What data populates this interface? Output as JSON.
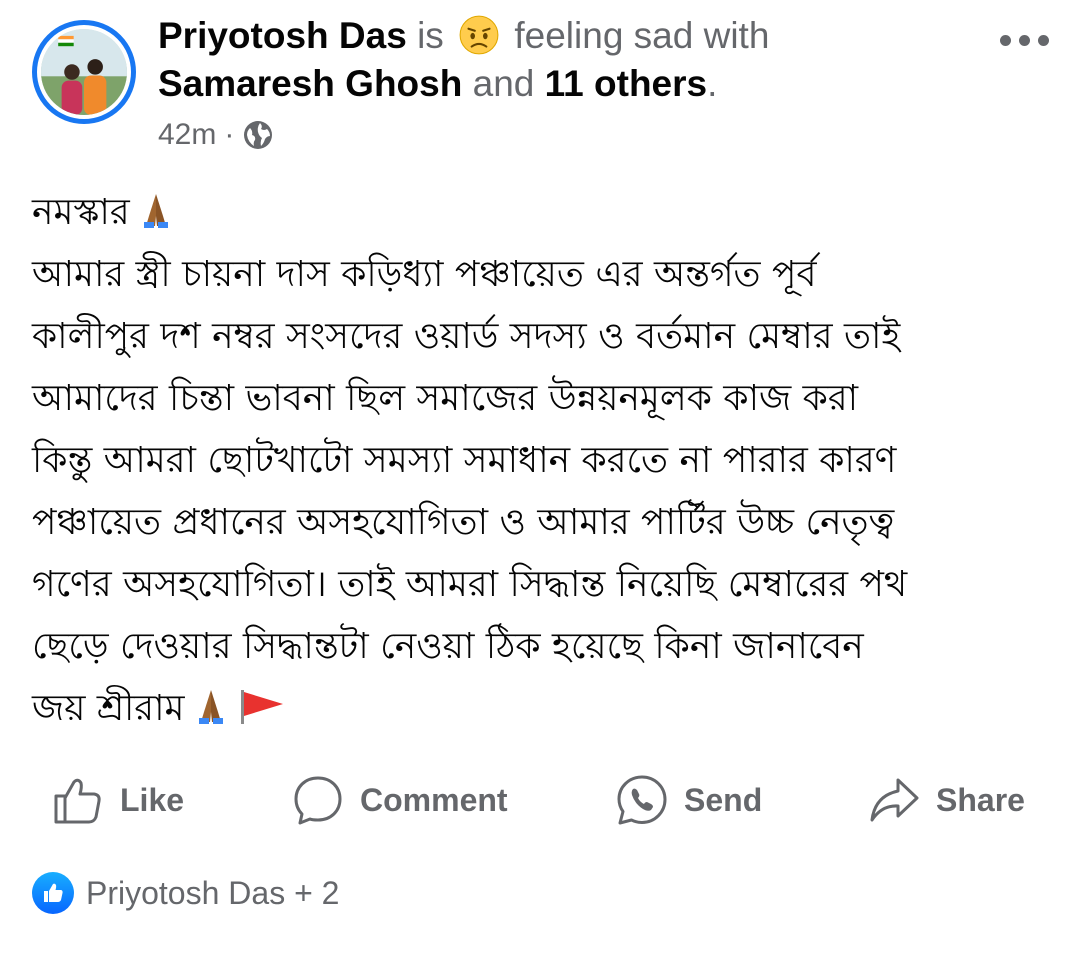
{
  "header": {
    "author": "Priyotosh Das",
    "is_text": "is",
    "feeling_text": "feeling sad with",
    "tagged": "Samaresh Ghosh",
    "and_text": "and",
    "others": "11 others",
    "period": ".",
    "time": "42m",
    "separator": "·",
    "feeling_icon": "sad-face-emoji",
    "privacy_icon": "globe-icon"
  },
  "body": {
    "lines": [
      "নমস্কার",
      "আমার স্ত্রী চায়না দাস কড়িধ্যা পঞ্চায়েত এর অন্তর্গত পূর্ব",
      "কালীপুর দশ নম্বর সংসদের ওয়ার্ড সদস্য ও বর্তমান মেম্বার তাই",
      "আমাদের চিন্তা ভাবনা ছিল সমাজের উন্নয়নমূলক কাজ করা",
      "কিন্তু আমরা ছোটখাটো সমস্যা সমাধান করতে না পারার কারণ",
      "পঞ্চায়েত প্রধানের অসহযোগিতা ও আমার পার্টির উচ্চ নেতৃত্ব",
      "গণের অসহযোগিতা। তাই আমরা সিদ্ধান্ত নিয়েছি মেম্বারের পথ",
      "ছেড়ে দেওয়ার সিদ্ধান্তটা নেওয়া ঠিক হয়েছে কিনা জানাবেন",
      "জয় শ্রীরাম"
    ]
  },
  "actions": {
    "like": "Like",
    "comment": "Comment",
    "send": "Send",
    "share": "Share"
  },
  "reactions": {
    "summary": "Priyotosh Das + 2"
  },
  "colors": {
    "accent": "#1877f2",
    "secondary_text": "#65676b",
    "primary_text": "#050505"
  }
}
